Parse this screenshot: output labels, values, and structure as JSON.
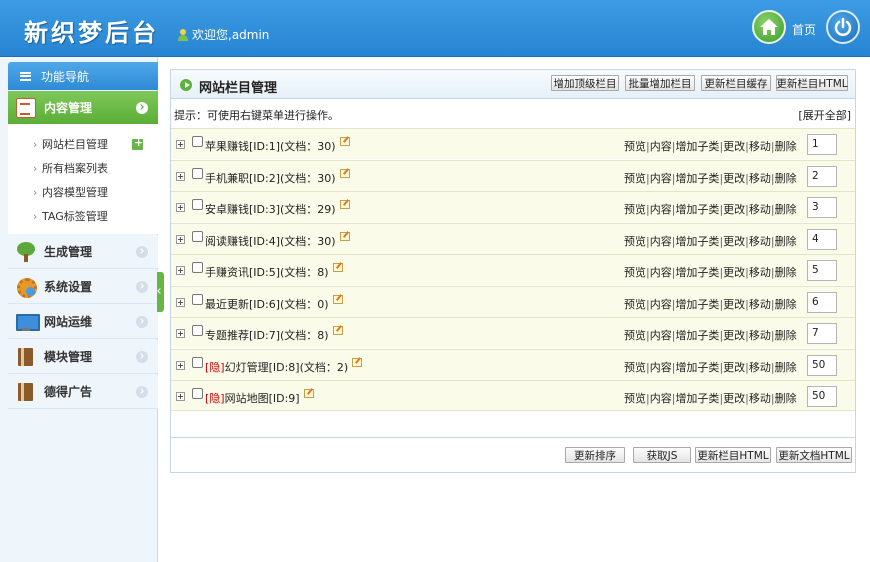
{
  "header": {
    "logo": "新织梦后台",
    "welcome": "欢迎您,admin",
    "home_label": "首页"
  },
  "sidebar": {
    "nav_title": "功能导航",
    "active_category": "内容管理",
    "sub_items": [
      {
        "label": "网站栏目管理"
      },
      {
        "label": "所有档案列表"
      },
      {
        "label": "内容模型管理"
      },
      {
        "label": "TAG标签管理"
      }
    ],
    "categories": [
      {
        "label": "生成管理",
        "icon": "tree-icon"
      },
      {
        "label": "系统设置",
        "icon": "gear-icon"
      },
      {
        "label": "网站运维",
        "icon": "monitor-icon"
      },
      {
        "label": "模块管理",
        "icon": "book-icon"
      },
      {
        "label": "德得广告",
        "icon": "book-icon"
      }
    ]
  },
  "panel": {
    "title": "网站栏目管理",
    "buttons": [
      "增加顶级栏目",
      "批量增加栏目",
      "更新栏目缓存",
      "更新栏目HTML"
    ],
    "tip": "提示：可使用右键菜单进行操作。",
    "expand_all": "[展开全部]",
    "hidden_tag": "[隐]",
    "actions": [
      "预览",
      "内容",
      "增加子类",
      "更改",
      "移动",
      "删除"
    ],
    "action_sep": "|",
    "rows": [
      {
        "name": "苹果赚钱[ID:1](文档：30)",
        "sort": "1"
      },
      {
        "name": "手机兼职[ID:2](文档：30)",
        "sort": "2"
      },
      {
        "name": "安卓赚钱[ID:3](文档：29)",
        "sort": "3"
      },
      {
        "name": "阅读赚钱[ID:4](文档：30)",
        "sort": "4"
      },
      {
        "name": "手赚资讯[ID:5](文档：8)",
        "sort": "5"
      },
      {
        "name": "最近更新[ID:6](文档：0)",
        "sort": "6"
      },
      {
        "name": "专题推荐[ID:7](文档：8)",
        "sort": "7"
      },
      {
        "name": "幻灯管理[ID:8](文档：2)",
        "sort": "50"
      },
      {
        "name": "网站地图[ID:9]",
        "sort": "50"
      }
    ],
    "bottom_buttons": [
      "更新排序",
      "获取JS",
      "更新栏目HTML",
      "更新文档HTML"
    ]
  },
  "colors": {
    "header_blue": "#2784d2",
    "active_green": "#5aae36",
    "row_bg": "#fbfbea",
    "hidden_red": "#cc0000"
  }
}
